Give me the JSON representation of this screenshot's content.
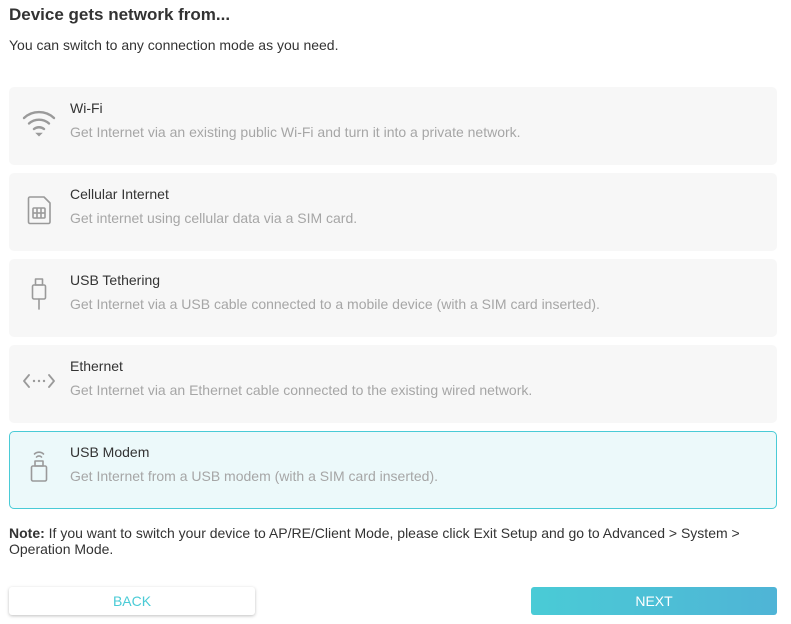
{
  "header": {
    "title": "Device gets network from...",
    "subtitle": "You can switch to any connection mode as you need."
  },
  "options": [
    {
      "label": "Wi-Fi",
      "description": "Get Internet via an existing public Wi-Fi and turn it into a private network.",
      "icon": "wifi-icon",
      "selected": false
    },
    {
      "label": "Cellular Internet",
      "description": "Get internet using cellular data via a SIM card.",
      "icon": "sim-card-icon",
      "selected": false
    },
    {
      "label": "USB Tethering",
      "description": "Get Internet via a USB cable connected to a mobile device (with a SIM card inserted).",
      "icon": "usb-cable-icon",
      "selected": false
    },
    {
      "label": "Ethernet",
      "description": "Get Internet via an Ethernet cable connected to the existing wired network.",
      "icon": "ethernet-icon",
      "selected": false
    },
    {
      "label": "USB Modem",
      "description": "Get Internet from a USB modem (with a SIM card inserted).",
      "icon": "usb-modem-icon",
      "selected": true
    }
  ],
  "note": {
    "prefix": "Note:",
    "text": " If you want to switch your device to AP/RE/Client Mode, please click Exit Setup and go to Advanced > System > Operation Mode."
  },
  "buttons": {
    "back_label": "BACK",
    "next_label": "NEXT"
  },
  "colors": {
    "accent": "#4acbd6",
    "selected_bg": "#ecf9fa",
    "card_bg": "#f7f7f7",
    "desc_text": "#a6a6a6"
  }
}
